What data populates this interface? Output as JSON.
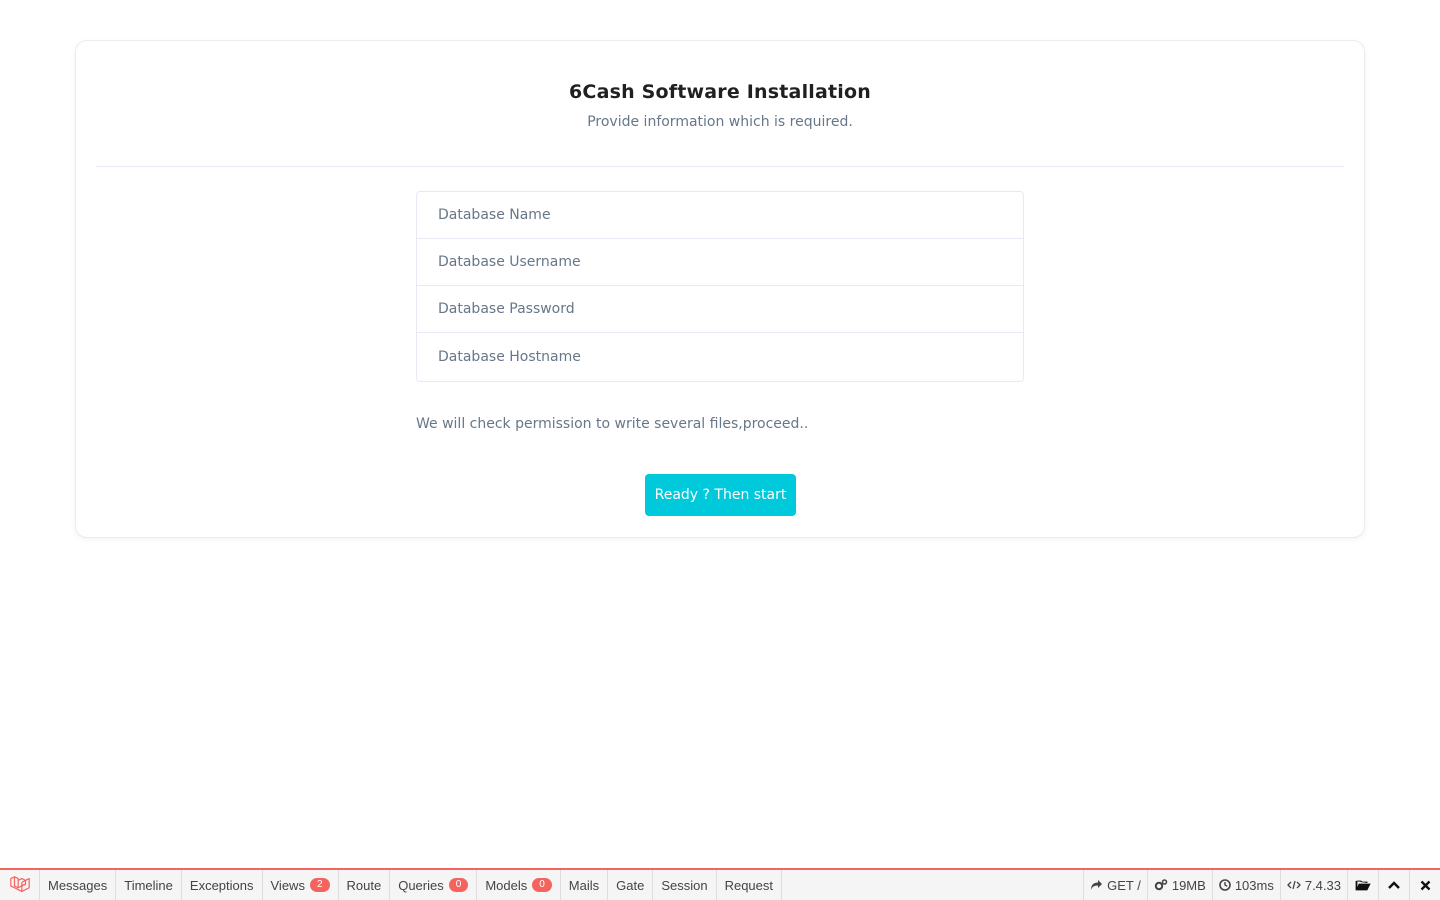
{
  "install": {
    "title": "6Cash Software Installation",
    "subtitle": "Provide information which is required.",
    "fields": [
      {
        "placeholder": "Database Name",
        "value": ""
      },
      {
        "placeholder": "Database Username",
        "value": ""
      },
      {
        "placeholder": "Database Password",
        "value": ""
      },
      {
        "placeholder": "Database Hostname",
        "value": ""
      }
    ],
    "note": "We will check permission to write several files,proceed..",
    "start_button": "Ready ? Then start"
  },
  "colors": {
    "primary_button": "#00c9db",
    "debugbar_accent": "#f4645f"
  },
  "debugbar": {
    "tabs": [
      {
        "label": "Messages",
        "badge": null
      },
      {
        "label": "Timeline",
        "badge": null
      },
      {
        "label": "Exceptions",
        "badge": null
      },
      {
        "label": "Views",
        "badge": "2"
      },
      {
        "label": "Route",
        "badge": null
      },
      {
        "label": "Queries",
        "badge": "0"
      },
      {
        "label": "Models",
        "badge": "0"
      },
      {
        "label": "Mails",
        "badge": null
      },
      {
        "label": "Gate",
        "badge": null
      },
      {
        "label": "Session",
        "badge": null
      },
      {
        "label": "Request",
        "badge": null
      }
    ],
    "method": "GET /",
    "memory": "19MB",
    "time": "103ms",
    "php_version": "7.4.33",
    "icons": {
      "logo": "laravel-logo-icon",
      "method": "share-arrow-icon",
      "memory": "cogs-icon",
      "time": "clock-icon",
      "version": "code-icon",
      "open": "folder-open-icon",
      "maximize": "chevron-up-icon",
      "close": "close-icon"
    }
  }
}
